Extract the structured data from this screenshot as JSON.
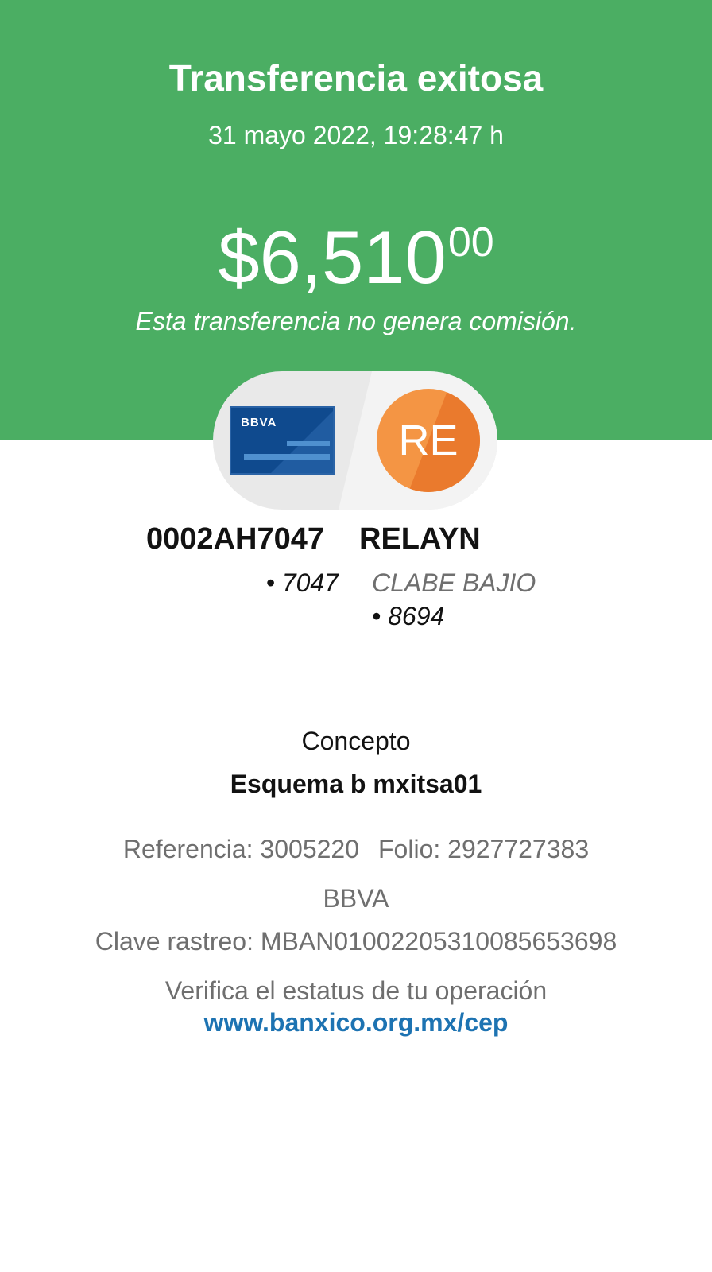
{
  "header": {
    "title": "Transferencia exitosa",
    "datetime": "31 mayo 2022, 19:28:47 h",
    "amount_main": "$6,510",
    "amount_cents": "00",
    "commission_note": "Esta transferencia no genera comisión."
  },
  "source": {
    "card_brand": "BBVA",
    "name": "0002AH7047",
    "account": "• 7047",
    "icon": "bank-card-icon"
  },
  "destination": {
    "initials": "RE",
    "name": "RELAYN",
    "bank": "CLABE BAJIO",
    "account": "• 8694",
    "icon": "avatar-initials"
  },
  "details": {
    "concept_label": "Concepto",
    "concept_value": "Esquema b mxitsa01",
    "reference": "Referencia: 3005220",
    "folio": "Folio: 2927727383",
    "bank": "BBVA",
    "tracking_key": "Clave rastreo: MBAN01002205310085653698",
    "verify_text": "Verifica el estatus de tu operación",
    "verify_link": "www.banxico.org.mx/cep"
  },
  "colors": {
    "header_green": "#4bae63",
    "avatar_orange": "#f0883a",
    "card_blue": "#0f4a8e",
    "link_blue": "#1d73b2"
  }
}
